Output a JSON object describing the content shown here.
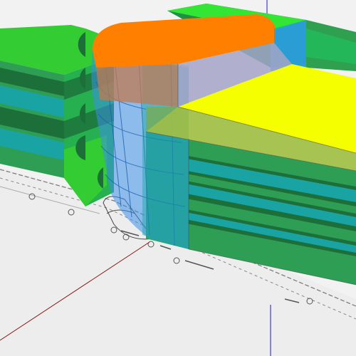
{
  "viewport": {
    "background": "#f2f2f2"
  },
  "colors": {
    "roof_left": "#33cc33",
    "roof_orange": "#ff8000",
    "roof_yellow": "#f5ff00",
    "roof_back": "#33e633",
    "facade_green": "#2e9e55",
    "band_dark": "#1d6f3a",
    "band_teal": "#1aa3a3",
    "glass_blue": "#3a8fe8",
    "axis_red": "#8b1a1a",
    "axis_blue": "#1c1cb8",
    "plan_line": "#666666"
  },
  "icons": {
    "grid_marker": "circle-marker-icon"
  }
}
